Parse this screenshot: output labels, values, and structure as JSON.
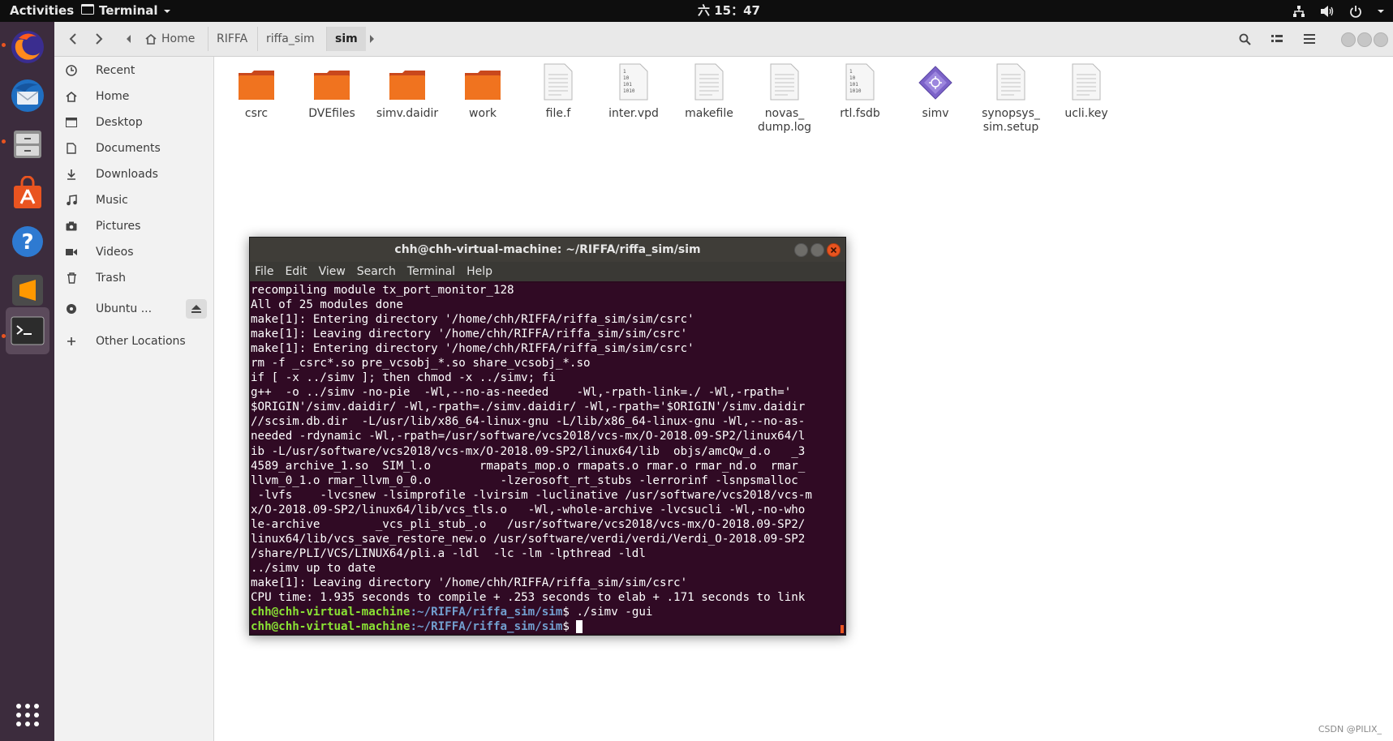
{
  "topbar": {
    "activities": "Activities",
    "app_menu": "Terminal",
    "clock": "六 15：47"
  },
  "files": {
    "breadcrumbs": [
      "Home",
      "RIFFA",
      "riffa_sim",
      "sim"
    ],
    "sidebar": [
      {
        "label": "Recent",
        "icon": "clock-icon"
      },
      {
        "label": "Home",
        "icon": "home-icon"
      },
      {
        "label": "Desktop",
        "icon": "desktop-icon"
      },
      {
        "label": "Documents",
        "icon": "document-icon"
      },
      {
        "label": "Downloads",
        "icon": "download-icon"
      },
      {
        "label": "Music",
        "icon": "music-icon"
      },
      {
        "label": "Pictures",
        "icon": "camera-icon"
      },
      {
        "label": "Videos",
        "icon": "video-icon"
      },
      {
        "label": "Trash",
        "icon": "trash-icon"
      },
      {
        "label": "Ubuntu ...",
        "icon": "disc-icon"
      },
      {
        "label": "Other Locations",
        "icon": "plus-icon"
      }
    ],
    "items": [
      {
        "name": "csrc",
        "type": "folder"
      },
      {
        "name": "DVEfiles",
        "type": "folder"
      },
      {
        "name": "simv.daidir",
        "type": "folder"
      },
      {
        "name": "work",
        "type": "folder"
      },
      {
        "name": "file.f",
        "type": "text"
      },
      {
        "name": "inter.vpd",
        "type": "binary"
      },
      {
        "name": "makefile",
        "type": "text"
      },
      {
        "name": "novas_\ndump.log",
        "type": "text"
      },
      {
        "name": "rtl.fsdb",
        "type": "binary"
      },
      {
        "name": "simv",
        "type": "executable"
      },
      {
        "name": "synopsys_\nsim.setup",
        "type": "text"
      },
      {
        "name": "ucli.key",
        "type": "text"
      }
    ]
  },
  "terminal": {
    "title": "chh@chh-virtual-machine: ~/RIFFA/riffa_sim/sim",
    "menu": [
      "File",
      "Edit",
      "View",
      "Search",
      "Terminal",
      "Help"
    ],
    "output": [
      "recompiling module tx_port_monitor_128",
      "All of 25 modules done",
      "make[1]: Entering directory '/home/chh/RIFFA/riffa_sim/sim/csrc'",
      "make[1]: Leaving directory '/home/chh/RIFFA/riffa_sim/sim/csrc'",
      "make[1]: Entering directory '/home/chh/RIFFA/riffa_sim/sim/csrc'",
      "rm -f _csrc*.so pre_vcsobj_*.so share_vcsobj_*.so",
      "if [ -x ../simv ]; then chmod -x ../simv; fi",
      "g++  -o ../simv -no-pie  -Wl,--no-as-needed    -Wl,-rpath-link=./ -Wl,-rpath='",
      "$ORIGIN'/simv.daidir/ -Wl,-rpath=./simv.daidir/ -Wl,-rpath='$ORIGIN'/simv.daidir",
      "//scsim.db.dir  -L/usr/lib/x86_64-linux-gnu -L/lib/x86_64-linux-gnu -Wl,--no-as-",
      "needed -rdynamic -Wl,-rpath=/usr/software/vcs2018/vcs-mx/O-2018.09-SP2/linux64/l",
      "ib -L/usr/software/vcs2018/vcs-mx/O-2018.09-SP2/linux64/lib  objs/amcQw_d.o   _3",
      "4589_archive_1.so  SIM_l.o       rmapats_mop.o rmapats.o rmar.o rmar_nd.o  rmar_",
      "llvm_0_1.o rmar_llvm_0_0.o          -lzerosoft_rt_stubs -lerrorinf -lsnpsmalloc",
      " -lvfs    -lvcsnew -lsimprofile -lvirsim -luclinative /usr/software/vcs2018/vcs-m",
      "x/O-2018.09-SP2/linux64/lib/vcs_tls.o   -Wl,-whole-archive -lvcsucli -Wl,-no-who",
      "le-archive        _vcs_pli_stub_.o   /usr/software/vcs2018/vcs-mx/O-2018.09-SP2/",
      "linux64/lib/vcs_save_restore_new.o /usr/software/verdi/verdi/Verdi_O-2018.09-SP2",
      "/share/PLI/VCS/LINUX64/pli.a -ldl  -lc -lm -lpthread -ldl",
      "../simv up to date",
      "make[1]: Leaving directory '/home/chh/RIFFA/riffa_sim/sim/csrc'",
      "CPU time: 1.935 seconds to compile + .253 seconds to elab + .171 seconds to link"
    ],
    "prompt_user": "chh@chh-virtual-machine",
    "prompt_path": ":~/RIFFA/riffa_sim/sim",
    "prompt_symbol": "$ ",
    "command1": "./simv -gui",
    "command2": ""
  },
  "watermark": "CSDN @PILIX_"
}
